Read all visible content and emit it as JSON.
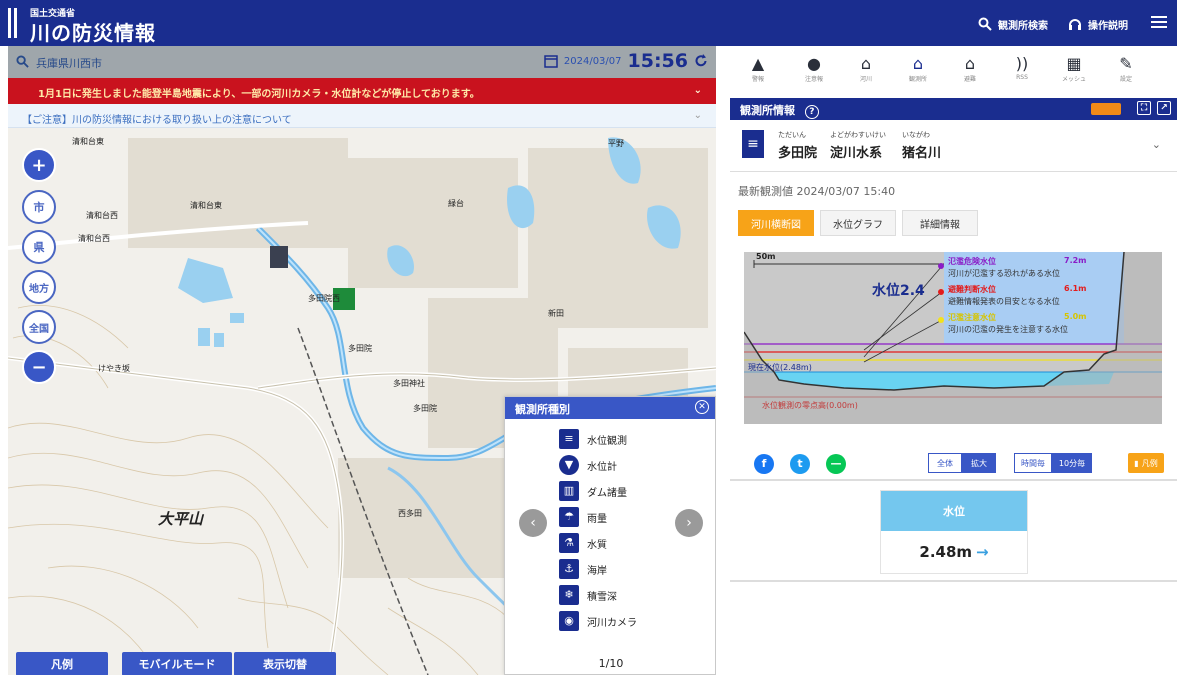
{
  "header": {
    "agency": "国土交通省",
    "title": "川の防災情報",
    "search_label": "観測所検索",
    "help_label": "操作説明"
  },
  "map_panel": {
    "search_text": "兵庫県川西市",
    "date": "2024/03/07",
    "time": "15:56",
    "alert": "1月1日に発生しました能登半島地震により、一部の河川カメラ・水位計などが停止しております。",
    "notice": "【ご注意】川の防災情報における取り扱い上の注意について",
    "zoom_buttons": [
      "市",
      "県",
      "地方",
      "全国"
    ],
    "place_labels": [
      "清和台東",
      "清和台東",
      "清和台西",
      "清和台西",
      "多田院",
      "多田院西",
      "けやき坂",
      "多田神社",
      "多田院",
      "大平山",
      "西多田",
      "平野",
      "新田",
      "緑台"
    ],
    "mountain": "大平山",
    "bottom_buttons": [
      "凡例",
      "モバイルモード",
      "表示切替"
    ],
    "station_types": {
      "title": "観測所種別",
      "items": [
        "水位観測",
        "水位計",
        "ダム諸量",
        "雨量",
        "水質",
        "海岸",
        "積雪深",
        "河川カメラ"
      ],
      "page": "1/10"
    }
  },
  "info_panel": {
    "tools": [
      "警報",
      "注意報",
      "河川",
      "観測所",
      "避難",
      "RSS",
      "メッシュ",
      "設定"
    ],
    "section_title": "観測所情報",
    "station": {
      "name_ruby": "ただいん",
      "name": "多田院",
      "system_ruby": "よどがわすいけい",
      "system": "淀川水系",
      "river_ruby": "いながわ",
      "river": "猪名川"
    },
    "latest_obs": "最新観測値 2024/03/07 15:40",
    "tabs": [
      "河川横断図",
      "水位グラフ",
      "詳細情報"
    ],
    "cross_section": {
      "scale": "50m",
      "water_label": "水位2.4",
      "levels": [
        {
          "name": "氾濫危険水位",
          "value": "7.2m",
          "desc": "河川が氾濫する恐れがある水位",
          "color": "#8a1cc7"
        },
        {
          "name": "避難判断水位",
          "value": "6.1m",
          "desc": "避難情報発表の目安となる水位",
          "color": "#e31c1c"
        },
        {
          "name": "氾濫注意水位",
          "value": "5.0m",
          "desc": "河川の氾濫の発生を注意する水位",
          "color": "#f2e21c"
        }
      ],
      "current_label": "現在水位(2.48m)",
      "zero_label": "水位観測の零点高(0.00m)"
    },
    "view_all": "全体",
    "view_zoom": "拡大",
    "period_1": "時間毎",
    "period_2": "10分毎",
    "legend": "凡例",
    "water_level_title": "水位",
    "water_level_value": "2.48m"
  }
}
